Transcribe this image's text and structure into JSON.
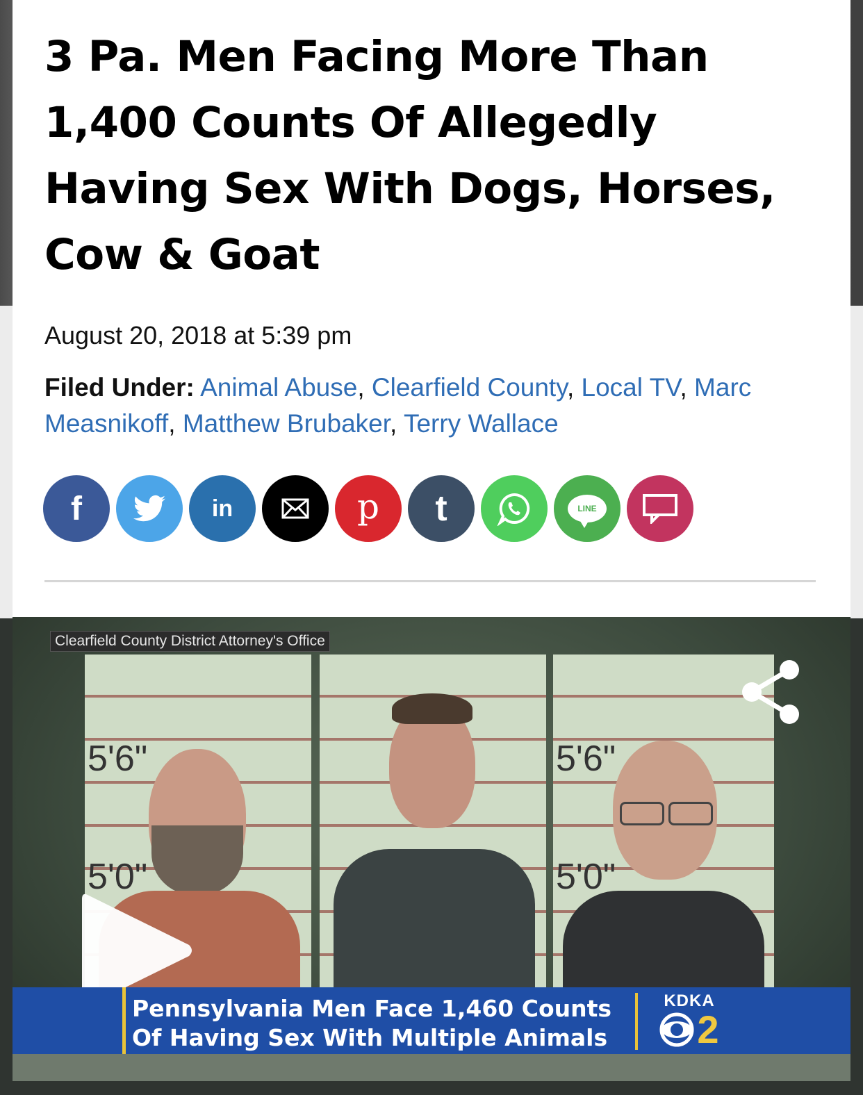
{
  "article": {
    "headline": "3 Pa. Men Facing More Than 1,400 Counts Of Allegedly Having Sex With Dogs, Horses, Cow & Goat",
    "date": "August 20, 2018 at 5:39 pm",
    "filed_under_label": "Filed Under:",
    "tags": [
      "Animal Abuse",
      "Clearfield County",
      "Local TV",
      "Marc Measnikoff",
      "Matthew Brubaker",
      "Terry Wallace"
    ]
  },
  "share": {
    "buttons": [
      {
        "name": "facebook",
        "icon": "facebook-icon",
        "color": "#3b5998",
        "glyph": "f"
      },
      {
        "name": "twitter",
        "icon": "twitter-icon",
        "color": "#4ca5e8"
      },
      {
        "name": "linkedin",
        "icon": "linkedin-icon",
        "color": "#2a70ad",
        "glyph": "in"
      },
      {
        "name": "email",
        "icon": "mail-icon",
        "color": "#000000"
      },
      {
        "name": "pinterest",
        "icon": "pinterest-icon",
        "color": "#d9272e",
        "glyph": "p"
      },
      {
        "name": "tumblr",
        "icon": "tumblr-icon",
        "color": "#3c4f66",
        "glyph": "t"
      },
      {
        "name": "whatsapp",
        "icon": "whatsapp-icon",
        "color": "#4fce5d"
      },
      {
        "name": "line",
        "icon": "line-icon",
        "color": "#4caf50",
        "glyph": "LINE"
      },
      {
        "name": "comment",
        "icon": "comment-icon",
        "color": "#c2345f"
      }
    ]
  },
  "video": {
    "credit": "Clearfield County District Attorney's Office",
    "mugshot_height_marks": [
      "5'6\"",
      "5'0\""
    ],
    "caption_line1": "Pennsylvania Men Face 1,460 Counts",
    "caption_line2": "Of Having Sex With Multiple Animals",
    "station_call": "KDKA",
    "station_channel": "2",
    "colors": {
      "banner": "#1f4ea6",
      "accent": "#e8c33a"
    }
  }
}
